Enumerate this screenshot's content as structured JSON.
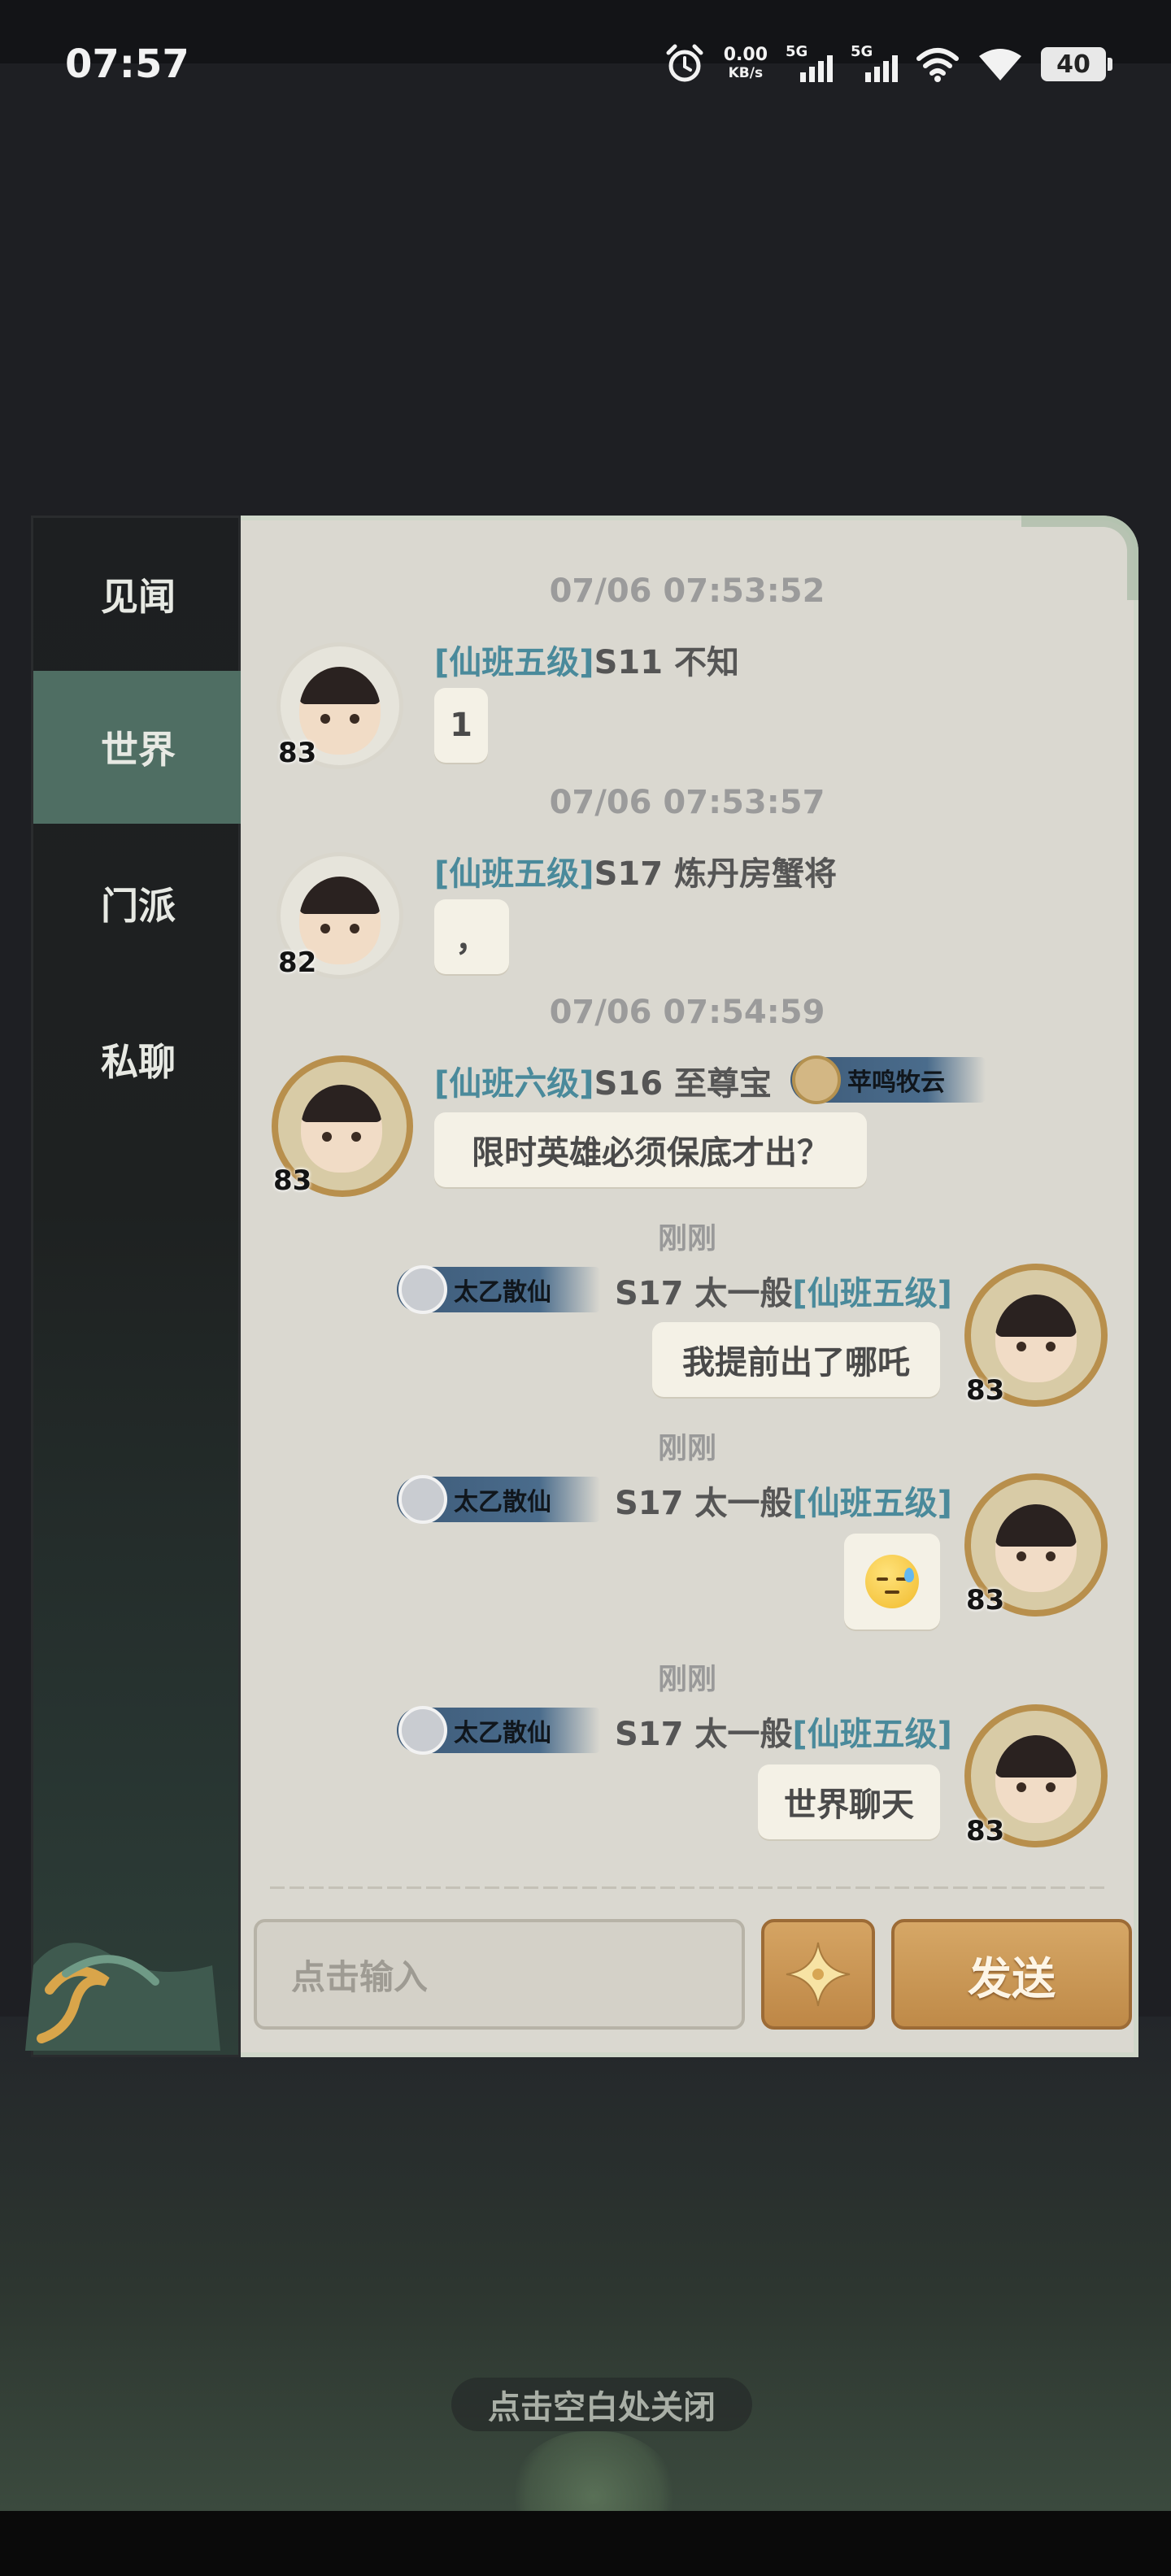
{
  "status_bar": {
    "time": "07:57",
    "net_speed_value": "0.00",
    "net_speed_unit": "KB/s",
    "sim1_tag": "5G",
    "sim2_tag": "5G",
    "battery_level": "40"
  },
  "sidebar": {
    "items": [
      {
        "label": "见闻",
        "active": false
      },
      {
        "label": "世界",
        "active": true
      },
      {
        "label": "门派",
        "active": false
      },
      {
        "label": "私聊",
        "active": false
      }
    ]
  },
  "messages": [
    {
      "timestamp": "07/06 07:53:52",
      "rank": "[仙班五级]",
      "name": "S11 不知",
      "level": "83",
      "text": "1",
      "side": "left"
    },
    {
      "timestamp": "07/06 07:53:57",
      "rank": "[仙班五级]",
      "name": "S17 炼丹房蟹将",
      "level": "82",
      "text": "，",
      "side": "left"
    },
    {
      "timestamp": "07/06 07:54:59",
      "rank": "[仙班六级]",
      "name": "S16 至尊宝",
      "level": "83",
      "badge": "苹鸣牧云",
      "text": "限时英雄必须保底才出？",
      "side": "left"
    },
    {
      "timestamp": "刚刚",
      "rank": "[仙班五级]",
      "name": "S17 太一般",
      "level": "83",
      "badge": "太乙散仙",
      "text": "我提前出了哪吒",
      "side": "right"
    },
    {
      "timestamp": "刚刚",
      "rank": "[仙班五级]",
      "name": "S17 太一般",
      "level": "83",
      "badge": "太乙散仙",
      "emoji": "sweat-smile-emoji",
      "side": "right"
    },
    {
      "timestamp": "刚刚",
      "rank": "[仙班五级]",
      "name": "S17 太一般",
      "level": "83",
      "badge": "太乙散仙",
      "text": "世界聊天",
      "side": "right"
    }
  ],
  "composer": {
    "placeholder": "点击输入",
    "emoji_button_icon": "four-point-star-icon",
    "send_label": "发送"
  },
  "close_hint": "点击空白处关闭",
  "colors": {
    "rank_text": "#4a8a9b",
    "active_tab": "#4f6e63",
    "send_button": "#c99552",
    "chat_background": "#dad8d0"
  }
}
